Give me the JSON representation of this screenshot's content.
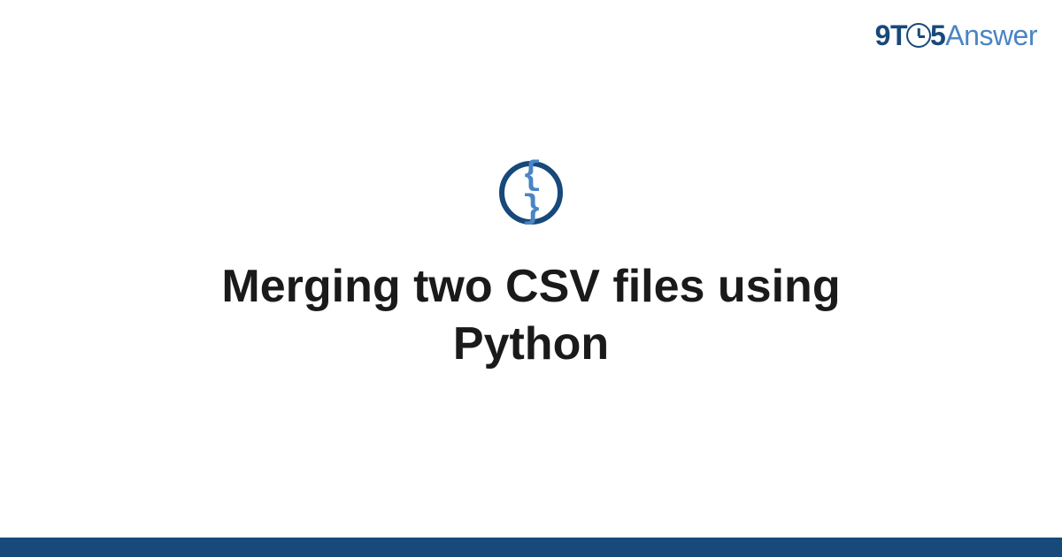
{
  "logo": {
    "part1": "9T",
    "part2": "5",
    "part3": "Answer"
  },
  "icon": {
    "name": "code-braces-icon",
    "glyph": "{ }"
  },
  "title": "Merging two CSV files using Python"
}
